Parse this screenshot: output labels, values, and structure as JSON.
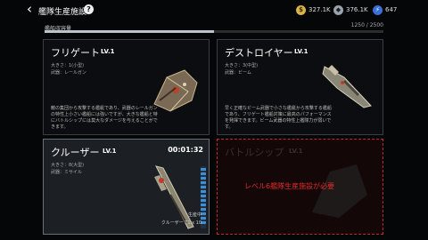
{
  "header": {
    "back_icon": "‹",
    "title": "艦隊生産施設",
    "help_icon": "?"
  },
  "resources": [
    {
      "icon_name": "coin-icon",
      "glyph": "$",
      "value": "327.1K",
      "color": "#d8b24a"
    },
    {
      "icon_name": "crystal-icon",
      "glyph": "◆",
      "value": "376.1K",
      "color": "#9aa3ad"
    },
    {
      "icon_name": "energy-icon",
      "glyph": "⚡",
      "value": "647",
      "color": "#3a6fd8"
    }
  ],
  "capacity": {
    "label": "艦船収容量",
    "value_text": "1250 / 2500",
    "fraction": 0.5
  },
  "cards": [
    {
      "name": "フリゲート",
      "level": "LV.1",
      "size": "大きさ：1(小型)",
      "weapon": "武器：レールガン",
      "desc": "敵の集団から攻撃する艦艇であり、武器のレールガンの特性上小さい艦船には強いですが、大きな艦船と特にバトルシップには莫大なダメージを与えることができます。"
    },
    {
      "name": "デストロイヤー",
      "level": "LV.1",
      "size": "大きさ：3(中型)",
      "weapon": "武器：ビーム",
      "desc": "早く正確なビーム武器で小さな艦艇から攻撃する艦船であり、フリゲート艦船対策に最高のパフォーマンスを発揮できます。ビーム武器の特性上艦隊力が弱いです。"
    },
    {
      "name": "クルーザー",
      "level": "LV.1",
      "size": "大きさ：8(大型)",
      "weapon": "武器：ミサイル",
      "timer": "00:01:32",
      "status": "生産中",
      "queue": "クルーザー T1 x 10"
    },
    {
      "name": "バトルシップ",
      "level": "LV.1",
      "lock_message": "レベル6艦隊生産施設が必要"
    }
  ]
}
